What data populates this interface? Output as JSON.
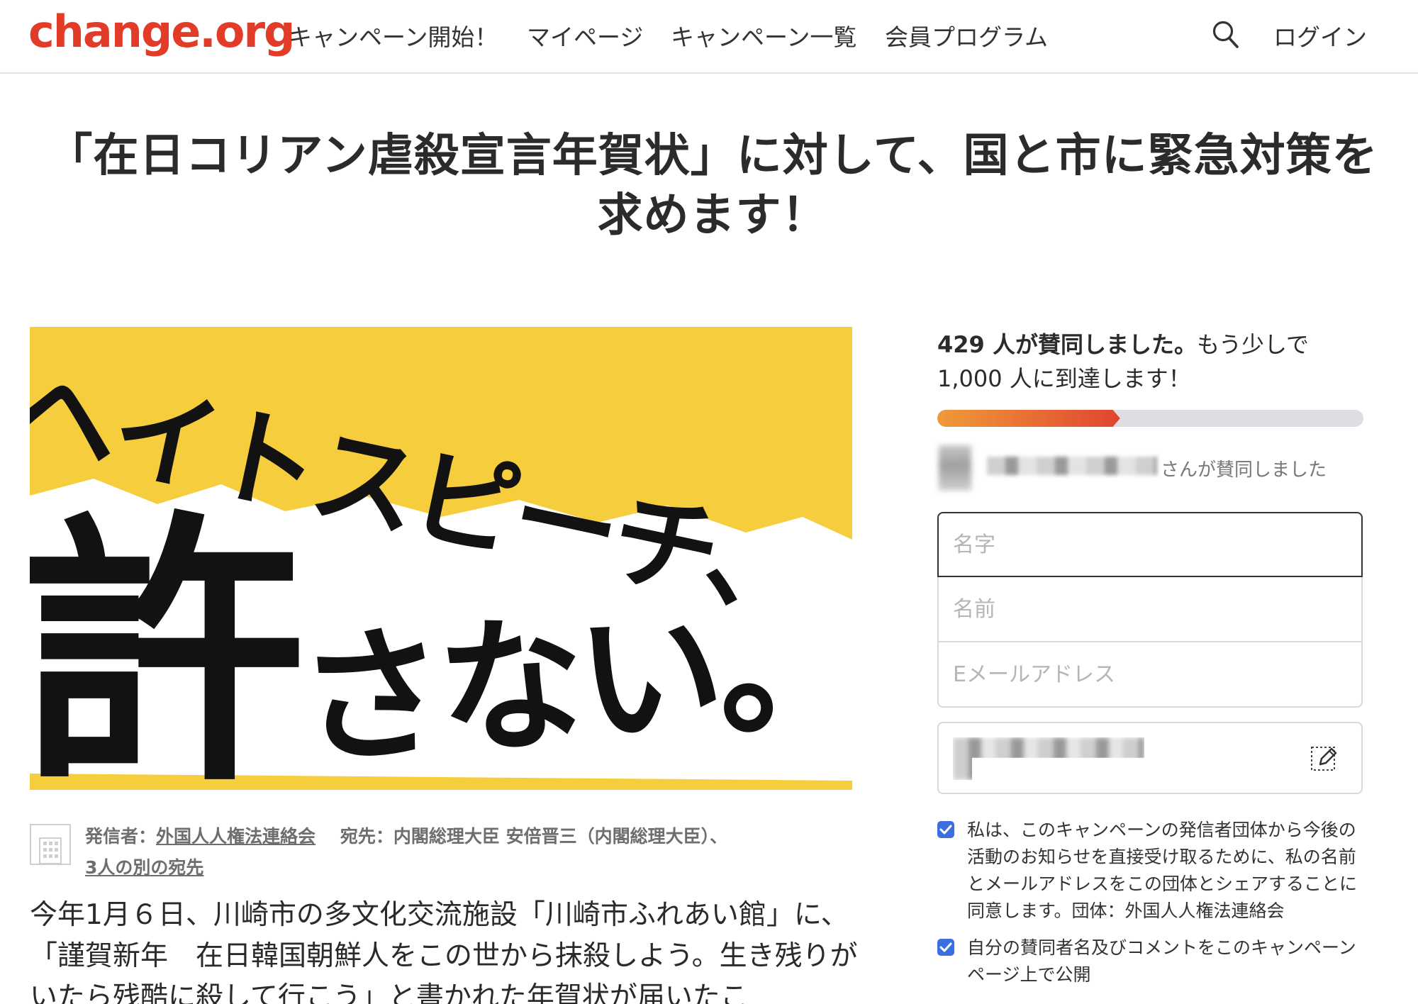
{
  "header": {
    "logo": "change.org",
    "nav": [
      "キャンペーン開始！",
      "マイページ",
      "キャンペーン一覧",
      "会員プログラム"
    ],
    "search_icon": "search-icon",
    "login": "ログイン"
  },
  "petition": {
    "title": "「在日コリアン虐殺宣言年賀状」に対して、国と市に緊急対策を求めます！",
    "image": {
      "line1": "ヘイトスピーチ、",
      "line2_kanji": "許",
      "line2_kana": "さない。",
      "background_color": "#f5cd3d"
    },
    "starter_label": "発信者：",
    "starter_name": "外国人人権法連絡会",
    "target_label": "宛先：内閣総理大臣 安倍晋三（内閣総理大臣）、",
    "other_targets": "3人の別の宛先",
    "body": "今年1月６日、川崎市の多文化交流施設「川崎市ふれあい館」に、「謹賀新年　在日韓国朝鮮人をこの世から抹殺しよう。生き残りがいたら残酷に殺して行こう」と書かれた年賀状が届いたこ"
  },
  "sidebar": {
    "count_bold": "429 人が賛同しました。",
    "count_rest": "もう少しで 1,000 人に到達します！",
    "progress_fraction": 0.429,
    "progress_color_start": "#f09a3a",
    "progress_color_end": "#e0452f",
    "recent_signer_suffix": "さんが賛同しました",
    "form": {
      "last_name_placeholder": "名字",
      "first_name_placeholder": "名前",
      "email_placeholder": "Eメールアドレス"
    },
    "edit_icon": "pencil-icon",
    "consent1": "私は、このキャンペーンの発信者団体から今後の活動のお知らせを直接受け取るために、私の名前とメールアドレスをこの団体とシェアすることに同意します。団体：外国人人権法連絡会",
    "consent2": "自分の賛同者名及びコメントをこのキャンペーンページ上で公開",
    "checkbox_color": "#3b6fe0"
  }
}
